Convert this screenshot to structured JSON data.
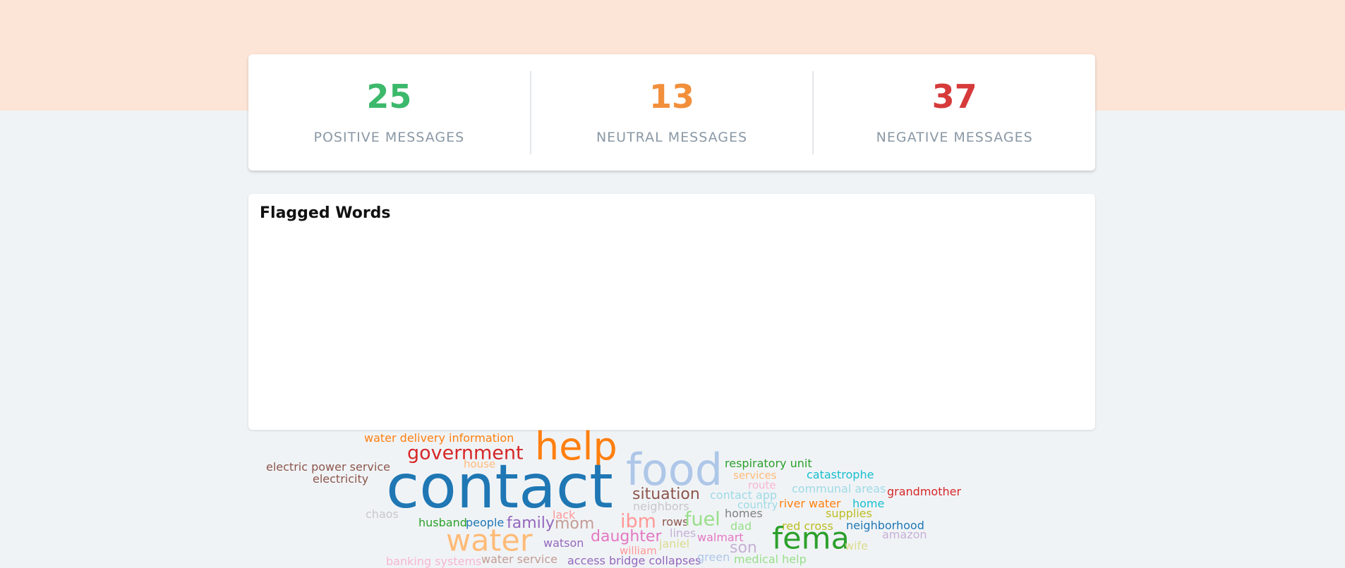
{
  "summary": [
    {
      "value": "25",
      "label": "POSITIVE MESSAGES",
      "color": "#3cb96b"
    },
    {
      "value": "13",
      "label": "NEUTRAL MESSAGES",
      "color": "#f28f3b"
    },
    {
      "value": "37",
      "label": "NEGATIVE MESSAGES",
      "color": "#d63a3a"
    }
  ],
  "flagged_words": {
    "title": "Flagged Words",
    "words": [
      {
        "text": "water delivery information",
        "color": "#ff7f0e"
      },
      {
        "text": "help",
        "color": "#ff7f0e"
      },
      {
        "text": "government",
        "color": "#d62728"
      },
      {
        "text": "house",
        "color": "#ffbb78"
      },
      {
        "text": "electric power service",
        "color": "#8c564b"
      },
      {
        "text": "electricity",
        "color": "#8c564b"
      },
      {
        "text": "contact",
        "color": "#1f77b4"
      },
      {
        "text": "food",
        "color": "#aec7e8"
      },
      {
        "text": "respiratory unit",
        "color": "#2ca02c"
      },
      {
        "text": "services",
        "color": "#ffbb78"
      },
      {
        "text": "catastrophe",
        "color": "#17becf"
      },
      {
        "text": "route",
        "color": "#f7b6d2"
      },
      {
        "text": "communal areas",
        "color": "#9edae5"
      },
      {
        "text": "grandmother",
        "color": "#d62728"
      },
      {
        "text": "situation",
        "color": "#8c564b"
      },
      {
        "text": "contact app",
        "color": "#9edae5"
      },
      {
        "text": "neighbors",
        "color": "#c7c7c7"
      },
      {
        "text": "country",
        "color": "#9edae5"
      },
      {
        "text": "river water",
        "color": "#ff7f0e"
      },
      {
        "text": "home",
        "color": "#17becf"
      },
      {
        "text": "chaos",
        "color": "#c7c7c7"
      },
      {
        "text": "lack",
        "color": "#ff9896"
      },
      {
        "text": "homes",
        "color": "#7f7f7f"
      },
      {
        "text": "supplies",
        "color": "#bcbd22"
      },
      {
        "text": "husband",
        "color": "#2ca02c"
      },
      {
        "text": "people",
        "color": "#1f77b4"
      },
      {
        "text": "family",
        "color": "#9467bd"
      },
      {
        "text": "mom",
        "color": "#c49c94"
      },
      {
        "text": "ibm",
        "color": "#ff9896"
      },
      {
        "text": "rows",
        "color": "#8c564b"
      },
      {
        "text": "fuel",
        "color": "#98df8a"
      },
      {
        "text": "dad",
        "color": "#98df8a"
      },
      {
        "text": "red cross",
        "color": "#bcbd22"
      },
      {
        "text": "neighborhood",
        "color": "#1f77b4"
      },
      {
        "text": "amazon",
        "color": "#c5b0d5"
      },
      {
        "text": "water",
        "color": "#ffbb78"
      },
      {
        "text": "lines",
        "color": "#c5b0d5"
      },
      {
        "text": "walmart",
        "color": "#e377c2"
      },
      {
        "text": "fema",
        "color": "#2ca02c"
      },
      {
        "text": "daughter",
        "color": "#e377c2"
      },
      {
        "text": "watson",
        "color": "#9467bd"
      },
      {
        "text": "janiel",
        "color": "#dbdb8d"
      },
      {
        "text": "son",
        "color": "#c5b0d5"
      },
      {
        "text": "wife",
        "color": "#dbdb8d"
      },
      {
        "text": "william",
        "color": "#ff9896"
      },
      {
        "text": "banking systems",
        "color": "#f7b6d2"
      },
      {
        "text": "water service",
        "color": "#c49c94"
      },
      {
        "text": "access bridge collapses",
        "color": "#9467bd"
      },
      {
        "text": "green",
        "color": "#aec7e8"
      },
      {
        "text": "medical help",
        "color": "#98df8a"
      }
    ]
  }
}
